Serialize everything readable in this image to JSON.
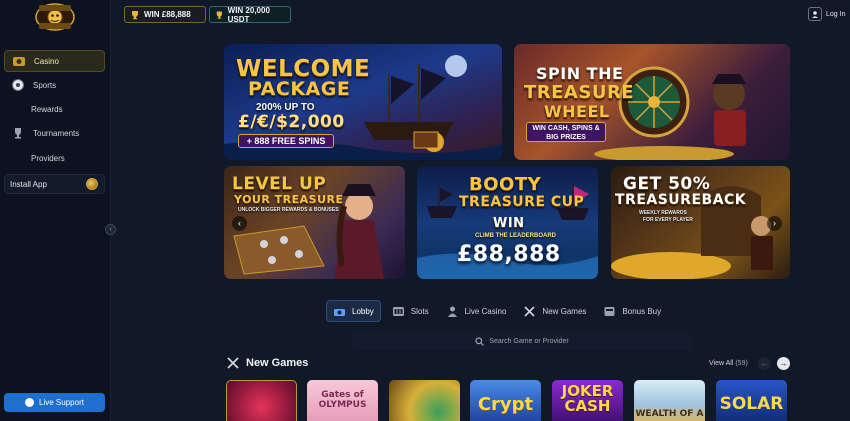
{
  "header": {
    "win_gbp": "WIN £88,888",
    "win_usdt": "WIN 20,000 USDT",
    "login": "Log In"
  },
  "logo": {
    "text": "BOOTY CASINO"
  },
  "sidebar": {
    "items": [
      {
        "label": "Casino",
        "icon": "casino-icon",
        "active": true
      },
      {
        "label": "Sports",
        "icon": "sports-icon",
        "active": false
      },
      {
        "label": "Rewards",
        "icon": "",
        "active": false
      },
      {
        "label": "Tournaments",
        "icon": "trophy-icon",
        "active": false
      },
      {
        "label": "Providers",
        "icon": "",
        "active": false
      }
    ],
    "install_app": "Install App",
    "live_support": "Live Support"
  },
  "banners": {
    "welcome": {
      "title_1": "WELCOME",
      "title_2": "PACKAGE",
      "line_1": "200% UP TO",
      "line_2": "£/€/$2,000",
      "line_3": "+ 888 FREE SPINS"
    },
    "wheel": {
      "title_1": "SPIN THE",
      "title_2": "TREASURE",
      "title_3": "WHEEL",
      "sub": "WIN CASH, SPINS & BIG PRIZES"
    },
    "level": {
      "title_1": "LEVEL UP",
      "title_2": "YOUR TREASURE",
      "sub": "UNLOCK BIGGER REWARDS & BONUSES"
    },
    "cup": {
      "title_1": "BOOTY",
      "title_2": "TREASURE CUP",
      "win": "WIN",
      "sub": "CLIMB THE LEADERBOARD",
      "amount": "£88,888"
    },
    "back": {
      "title_1": "GET 50%",
      "title_2": "TREASUREBACK",
      "sub_1": "WEEKLY REWARDS",
      "sub_2": "FOR EVERY PLAYER"
    }
  },
  "tabs": [
    {
      "label": "Lobby",
      "icon": "lobby-icon",
      "active": true
    },
    {
      "label": "Slots",
      "icon": "slots-icon",
      "active": false
    },
    {
      "label": "Live Casino",
      "icon": "live-casino-icon",
      "active": false
    },
    {
      "label": "New Games",
      "icon": "swords-icon",
      "active": false
    },
    {
      "label": "Bonus Buy",
      "icon": "bonus-buy-icon",
      "active": false
    }
  ],
  "search": {
    "placeholder": "Search Game or Provider"
  },
  "new_games": {
    "title": "New Games",
    "view_all": "View All",
    "count": "(59)",
    "games": [
      {
        "label": "",
        "bg": "#7a0f3a"
      },
      {
        "label": "Gates of OLYMPUS",
        "bg": "#f2b7c8"
      },
      {
        "label": "",
        "bg": "#e9c14a"
      },
      {
        "label": "Crypt",
        "bg": "#2d4fb8"
      },
      {
        "label": "JOKER CASH",
        "bg": "#6a1fb0"
      },
      {
        "label": "WEALTH OF A",
        "bg": "#cfe4f4"
      },
      {
        "label": "SOLAR",
        "bg": "#1f3fa0"
      }
    ]
  },
  "colors": {
    "bg": "#111827",
    "sidebar": "#0d1220",
    "accent_gold": "#f6c544",
    "support_blue": "#1f6fd1"
  }
}
